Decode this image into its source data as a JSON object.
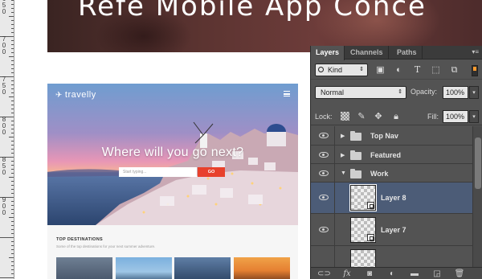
{
  "ruler": {
    "labels": [
      {
        "digits": [
          "6",
          "5",
          "0"
        ]
      },
      {
        "digits": [
          "7",
          "0",
          "0"
        ]
      },
      {
        "digits": [
          "7",
          "5",
          "0"
        ]
      },
      {
        "digits": [
          "8",
          "0",
          "0"
        ]
      },
      {
        "digits": [
          "8",
          "5",
          "0"
        ]
      },
      {
        "digits": [
          "9",
          "0",
          "0"
        ]
      }
    ]
  },
  "artboard": {
    "title": "Refe Mobile App Conce"
  },
  "site": {
    "brand": "travelly",
    "headline": "Where will you go next?",
    "search_placeholder": "Start typing...",
    "go_label": "GO",
    "destinations_heading": "TOP DESTINATIONS",
    "destinations_sub": "Some of the top destinations for your next summer adventure."
  },
  "panel": {
    "tabs": [
      "Layers",
      "Channels",
      "Paths"
    ],
    "active_tab": "Layers",
    "filter_kind": "Kind",
    "blend_mode": "Normal",
    "opacity_label": "Opacity:",
    "opacity_value": "100%",
    "lock_label": "Lock:",
    "fill_label": "Fill:",
    "fill_value": "100%",
    "layers": [
      {
        "name": "Top Nav",
        "type": "group",
        "expanded": false,
        "selected": false
      },
      {
        "name": "Featured",
        "type": "group",
        "expanded": false,
        "selected": false
      },
      {
        "name": "Work",
        "type": "group",
        "expanded": true,
        "selected": false
      },
      {
        "name": "Layer 8",
        "type": "smart-object",
        "selected": true
      },
      {
        "name": "Layer 7",
        "type": "smart-object",
        "selected": false
      }
    ]
  },
  "colors": {
    "panel_bg": "#535353",
    "selected_row": "#4c5c77",
    "go_button": "#e8412c"
  }
}
